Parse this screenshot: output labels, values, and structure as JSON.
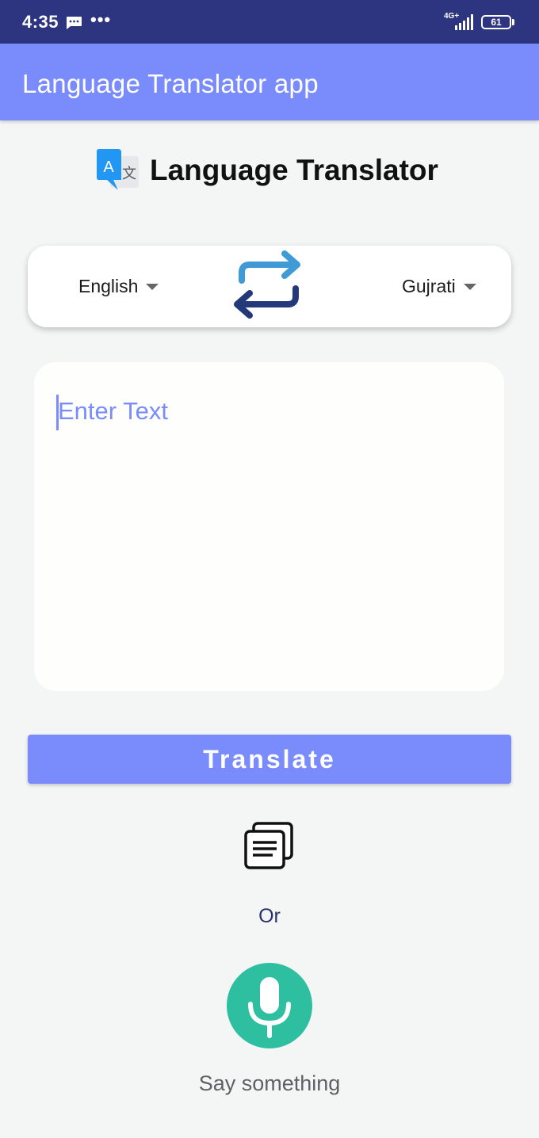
{
  "status_bar": {
    "time": "4:35",
    "icons": [
      "message-icon",
      "more-dots-icon",
      "signal-icon",
      "battery-icon"
    ],
    "more": "•••",
    "network": "4G+",
    "battery": "61"
  },
  "app_bar": {
    "title": "Language Translator app",
    "color": "#7a8cfc"
  },
  "header": {
    "logo_icon": "translate-icon",
    "title": "Language Translator"
  },
  "languages": {
    "source": "English",
    "target": "Gujrati",
    "swap_icon": "swap-arrows-icon"
  },
  "input": {
    "placeholder": "Enter Text",
    "value": ""
  },
  "actions": {
    "translate_label": "Translate",
    "copy_icon": "copy-document-icon",
    "or_label": "Or",
    "mic_icon": "microphone-icon",
    "say_label": "Say something",
    "mic_color": "#2ebfa1"
  }
}
